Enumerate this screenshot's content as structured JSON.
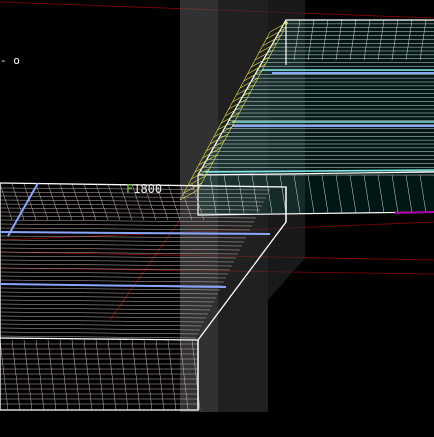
{
  "viewport": {
    "background": "#000000",
    "dimension_label": {
      "prefix": "F",
      "value": "1800"
    },
    "corner_mark": "- o",
    "colors": {
      "slab_outline": "#ffffff",
      "slab_mesh": "#c8b8b8",
      "slab_mesh_right": "#d8d8d8",
      "rebar_cyan": "#7fe8e8",
      "rebar_blue": "#8aa8ff",
      "rebar_yellow": "#e6e64a",
      "column_gray": "#6a6a6a",
      "guide_red": "#a00000",
      "accent_magenta": "#b000b0"
    }
  }
}
